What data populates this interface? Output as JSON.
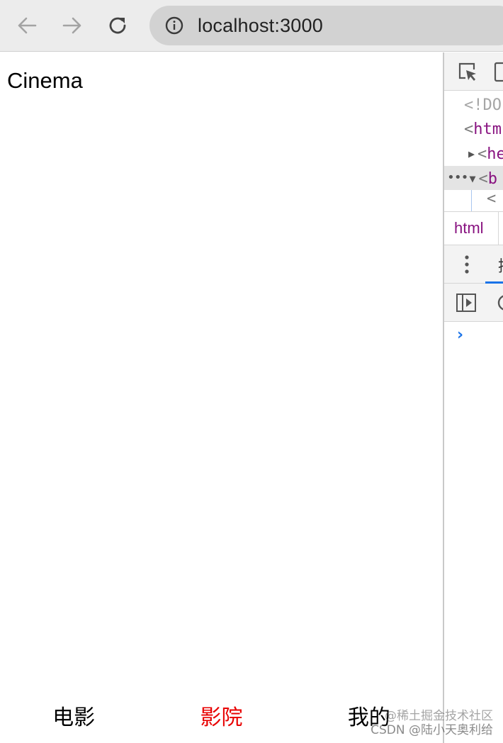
{
  "browser": {
    "url": "localhost:3000",
    "icons": {
      "back": "arrow-left-icon",
      "forward": "arrow-right-icon",
      "reload": "reload-icon",
      "site_info": "info-icon"
    }
  },
  "page": {
    "title": "Cinema",
    "tabs": [
      {
        "label": "电影",
        "active": false
      },
      {
        "label": "影院",
        "active": true
      },
      {
        "label": "我的",
        "active": false
      }
    ],
    "active_color": "#e80000"
  },
  "devtools": {
    "dom": {
      "doctype": "<!DO",
      "html_tag": "htm",
      "head_tag": "he",
      "body_tag": "b",
      "child_lt": "<",
      "lt": "<"
    },
    "breadcrumb": "html",
    "drawer_tab_fragment": "控",
    "console_prompt": "›",
    "dots": "•••"
  },
  "watermark": {
    "line1": "@稀土掘金技术社区",
    "line2": "CSDN @陆小天奥利给"
  }
}
